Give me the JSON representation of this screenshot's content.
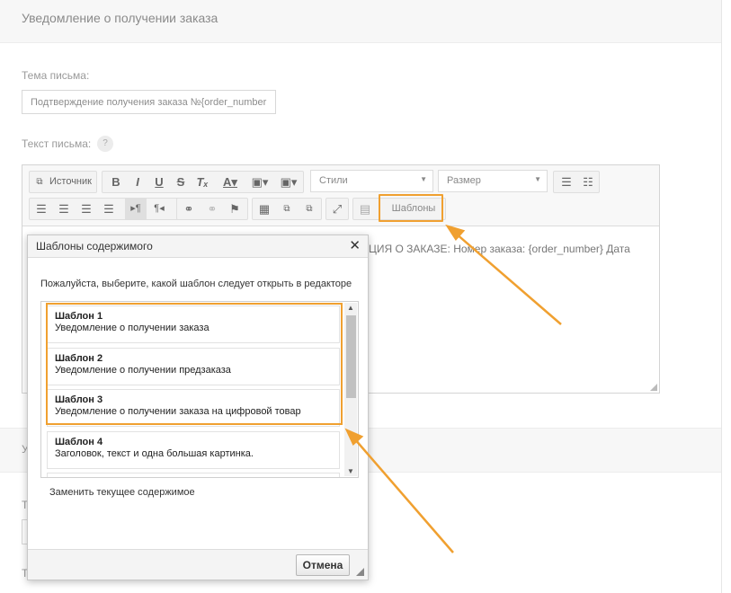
{
  "section": {
    "title": "Уведомление о получении заказа"
  },
  "subject": {
    "label": "Тема письма:",
    "value": "Подтверждение получения заказа №{order_number"
  },
  "body": {
    "label": "Текст письма:",
    "help": "?"
  },
  "toolbar": {
    "source_label": "Источник",
    "styles_label": "Стили",
    "size_label": "Размер",
    "templates_label": "Шаблоны"
  },
  "editor": {
    "content_text": "ЦИЯ О ЗАКАЗЕ: Номер заказа: {order_number} Дата"
  },
  "dialog": {
    "title": "Шаблоны содержимого",
    "close": "✕",
    "prompt": "Пожалуйста, выберите, какой шаблон следует открыть в редакторе",
    "templates": [
      {
        "name": "Шаблон 1",
        "desc": "Уведомление о получении заказа"
      },
      {
        "name": "Шаблон 2",
        "desc": "Уведомление о получении предзаказа"
      },
      {
        "name": "Шаблон 3",
        "desc": "Уведомление о получении заказа на цифровой товар"
      },
      {
        "name": "Шаблон 4",
        "desc": "Заголовок, текст и одна большая картинка."
      }
    ],
    "replace_label": "Заменить текущее содержимое",
    "cancel_label": "Отмена"
  },
  "background_fragments": {
    "frag1": "У",
    "frag2": "Т",
    "frag3": "Т"
  },
  "colors": {
    "highlight": "#f0a030"
  }
}
